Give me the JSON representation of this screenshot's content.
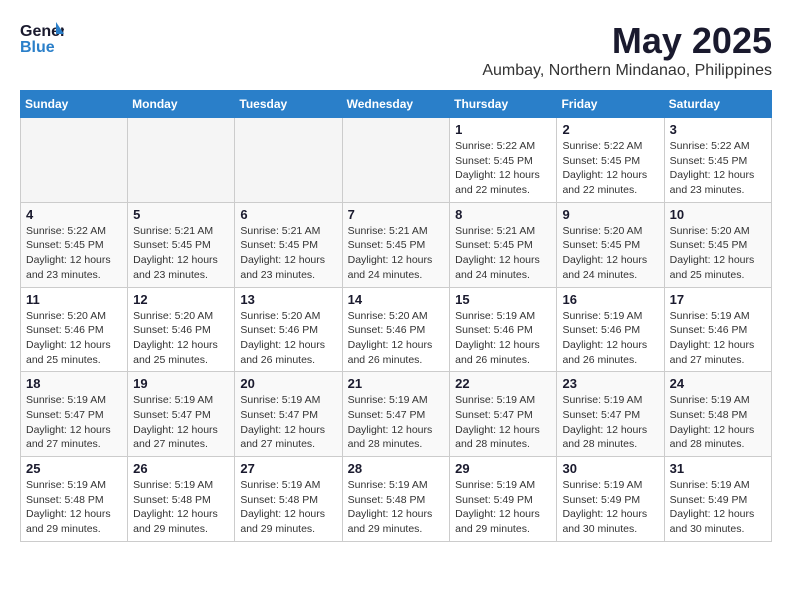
{
  "header": {
    "logo_general": "General",
    "logo_blue": "Blue",
    "month": "May 2025",
    "location": "Aumbay, Northern Mindanao, Philippines"
  },
  "weekdays": [
    "Sunday",
    "Monday",
    "Tuesday",
    "Wednesday",
    "Thursday",
    "Friday",
    "Saturday"
  ],
  "weeks": [
    [
      {
        "day": "",
        "info": ""
      },
      {
        "day": "",
        "info": ""
      },
      {
        "day": "",
        "info": ""
      },
      {
        "day": "",
        "info": ""
      },
      {
        "day": "1",
        "info": "Sunrise: 5:22 AM\nSunset: 5:45 PM\nDaylight: 12 hours\nand 22 minutes."
      },
      {
        "day": "2",
        "info": "Sunrise: 5:22 AM\nSunset: 5:45 PM\nDaylight: 12 hours\nand 22 minutes."
      },
      {
        "day": "3",
        "info": "Sunrise: 5:22 AM\nSunset: 5:45 PM\nDaylight: 12 hours\nand 23 minutes."
      }
    ],
    [
      {
        "day": "4",
        "info": "Sunrise: 5:22 AM\nSunset: 5:45 PM\nDaylight: 12 hours\nand 23 minutes."
      },
      {
        "day": "5",
        "info": "Sunrise: 5:21 AM\nSunset: 5:45 PM\nDaylight: 12 hours\nand 23 minutes."
      },
      {
        "day": "6",
        "info": "Sunrise: 5:21 AM\nSunset: 5:45 PM\nDaylight: 12 hours\nand 23 minutes."
      },
      {
        "day": "7",
        "info": "Sunrise: 5:21 AM\nSunset: 5:45 PM\nDaylight: 12 hours\nand 24 minutes."
      },
      {
        "day": "8",
        "info": "Sunrise: 5:21 AM\nSunset: 5:45 PM\nDaylight: 12 hours\nand 24 minutes."
      },
      {
        "day": "9",
        "info": "Sunrise: 5:20 AM\nSunset: 5:45 PM\nDaylight: 12 hours\nand 24 minutes."
      },
      {
        "day": "10",
        "info": "Sunrise: 5:20 AM\nSunset: 5:45 PM\nDaylight: 12 hours\nand 25 minutes."
      }
    ],
    [
      {
        "day": "11",
        "info": "Sunrise: 5:20 AM\nSunset: 5:46 PM\nDaylight: 12 hours\nand 25 minutes."
      },
      {
        "day": "12",
        "info": "Sunrise: 5:20 AM\nSunset: 5:46 PM\nDaylight: 12 hours\nand 25 minutes."
      },
      {
        "day": "13",
        "info": "Sunrise: 5:20 AM\nSunset: 5:46 PM\nDaylight: 12 hours\nand 26 minutes."
      },
      {
        "day": "14",
        "info": "Sunrise: 5:20 AM\nSunset: 5:46 PM\nDaylight: 12 hours\nand 26 minutes."
      },
      {
        "day": "15",
        "info": "Sunrise: 5:19 AM\nSunset: 5:46 PM\nDaylight: 12 hours\nand 26 minutes."
      },
      {
        "day": "16",
        "info": "Sunrise: 5:19 AM\nSunset: 5:46 PM\nDaylight: 12 hours\nand 26 minutes."
      },
      {
        "day": "17",
        "info": "Sunrise: 5:19 AM\nSunset: 5:46 PM\nDaylight: 12 hours\nand 27 minutes."
      }
    ],
    [
      {
        "day": "18",
        "info": "Sunrise: 5:19 AM\nSunset: 5:47 PM\nDaylight: 12 hours\nand 27 minutes."
      },
      {
        "day": "19",
        "info": "Sunrise: 5:19 AM\nSunset: 5:47 PM\nDaylight: 12 hours\nand 27 minutes."
      },
      {
        "day": "20",
        "info": "Sunrise: 5:19 AM\nSunset: 5:47 PM\nDaylight: 12 hours\nand 27 minutes."
      },
      {
        "day": "21",
        "info": "Sunrise: 5:19 AM\nSunset: 5:47 PM\nDaylight: 12 hours\nand 28 minutes."
      },
      {
        "day": "22",
        "info": "Sunrise: 5:19 AM\nSunset: 5:47 PM\nDaylight: 12 hours\nand 28 minutes."
      },
      {
        "day": "23",
        "info": "Sunrise: 5:19 AM\nSunset: 5:47 PM\nDaylight: 12 hours\nand 28 minutes."
      },
      {
        "day": "24",
        "info": "Sunrise: 5:19 AM\nSunset: 5:48 PM\nDaylight: 12 hours\nand 28 minutes."
      }
    ],
    [
      {
        "day": "25",
        "info": "Sunrise: 5:19 AM\nSunset: 5:48 PM\nDaylight: 12 hours\nand 29 minutes."
      },
      {
        "day": "26",
        "info": "Sunrise: 5:19 AM\nSunset: 5:48 PM\nDaylight: 12 hours\nand 29 minutes."
      },
      {
        "day": "27",
        "info": "Sunrise: 5:19 AM\nSunset: 5:48 PM\nDaylight: 12 hours\nand 29 minutes."
      },
      {
        "day": "28",
        "info": "Sunrise: 5:19 AM\nSunset: 5:48 PM\nDaylight: 12 hours\nand 29 minutes."
      },
      {
        "day": "29",
        "info": "Sunrise: 5:19 AM\nSunset: 5:49 PM\nDaylight: 12 hours\nand 29 minutes."
      },
      {
        "day": "30",
        "info": "Sunrise: 5:19 AM\nSunset: 5:49 PM\nDaylight: 12 hours\nand 30 minutes."
      },
      {
        "day": "31",
        "info": "Sunrise: 5:19 AM\nSunset: 5:49 PM\nDaylight: 12 hours\nand 30 minutes."
      }
    ]
  ]
}
